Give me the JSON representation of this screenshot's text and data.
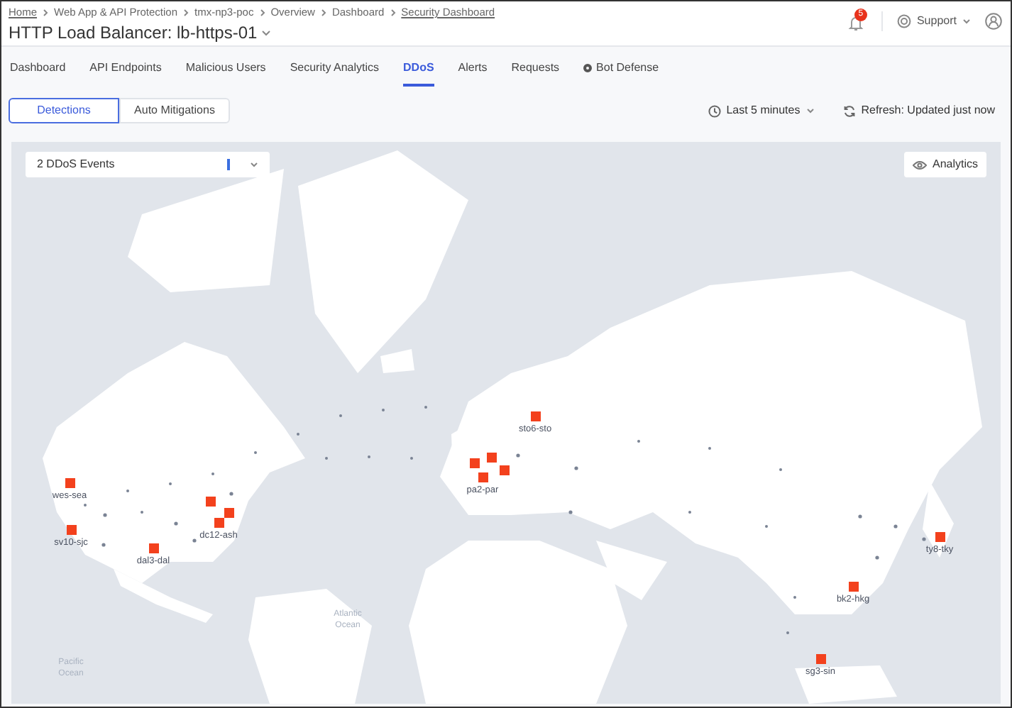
{
  "breadcrumb": [
    {
      "label": "Home",
      "link": true
    },
    {
      "label": "Web App & API Protection",
      "link": false
    },
    {
      "label": "tmx-np3-poc",
      "link": false
    },
    {
      "label": "Overview",
      "link": false
    },
    {
      "label": "Dashboard",
      "link": false
    },
    {
      "label": "Security Dashboard",
      "link": true
    }
  ],
  "title": "HTTP Load Balancer: lb-https-01",
  "notifications": {
    "count": "5"
  },
  "support": "Support",
  "tabs": [
    {
      "label": "Dashboard",
      "selected": false
    },
    {
      "label": "API Endpoints",
      "selected": false
    },
    {
      "label": "Malicious Users",
      "selected": false
    },
    {
      "label": "Security Analytics",
      "selected": false
    },
    {
      "label": "DDoS",
      "selected": true
    },
    {
      "label": "Alerts",
      "selected": false
    },
    {
      "label": "Requests",
      "selected": false
    },
    {
      "label": "Bot Defense",
      "selected": false,
      "icon": true
    }
  ],
  "segments": [
    {
      "label": "Detections",
      "selected": true
    },
    {
      "label": "Auto Mitigations",
      "selected": false
    }
  ],
  "time_range": "Last 5 minutes",
  "refresh": "Refresh: Updated just now",
  "map": {
    "events_select": "2 DDoS Events",
    "analytics_button": "Analytics",
    "oceans": [
      "Atlantic Ocean",
      "Pacific Ocean"
    ],
    "sites": [
      {
        "label": "wes-sea"
      },
      {
        "label": "sv10-sjc"
      },
      {
        "label": "dal3-dal"
      },
      {
        "label": "dc12-ash"
      },
      {
        "label": "pa2-par"
      },
      {
        "label": "sto6-sto"
      },
      {
        "label": "ty8-tky"
      },
      {
        "label": "bk2-hkg"
      },
      {
        "label": "sg3-sin"
      }
    ]
  }
}
